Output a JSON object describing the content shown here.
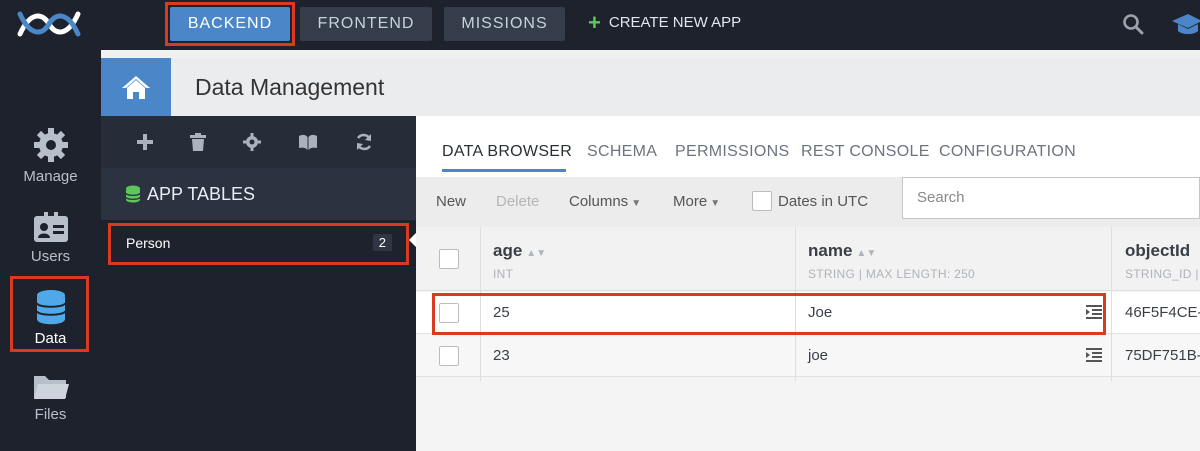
{
  "topbar": {
    "nav": [
      "BACKEND",
      "FRONTEND",
      "MISSIONS"
    ],
    "create_app": "CREATE NEW APP"
  },
  "sidebar": {
    "items": [
      {
        "label": "Manage",
        "icon": "gear-icon"
      },
      {
        "label": "Users",
        "icon": "id-card-icon"
      },
      {
        "label": "Data",
        "icon": "database-icon"
      },
      {
        "label": "Files",
        "icon": "folder-icon"
      }
    ],
    "active": "Data"
  },
  "header": {
    "title": "Data Management"
  },
  "tables_panel": {
    "section_title": "APP TABLES",
    "tables": [
      {
        "name": "Person",
        "count": "2"
      }
    ]
  },
  "tabs": [
    "DATA BROWSER",
    "SCHEMA",
    "PERMISSIONS",
    "REST CONSOLE",
    "CONFIGURATION"
  ],
  "toolbar": {
    "new": "New",
    "delete": "Delete",
    "columns": "Columns",
    "more": "More",
    "dates_utc": "Dates in UTC",
    "search_placeholder": "Search"
  },
  "grid": {
    "columns": [
      {
        "name": "age",
        "type": "INT"
      },
      {
        "name": "name",
        "type": "STRING | MAX LENGTH: 250"
      },
      {
        "name": "objectId",
        "type": "STRING_ID |"
      }
    ],
    "rows": [
      {
        "age": "25",
        "name": "Joe",
        "objectId": "46F5F4CE-("
      },
      {
        "age": "23",
        "name": "joe",
        "objectId": "75DF751B-"
      }
    ]
  },
  "colors": {
    "accent": "#4a86c8",
    "dark_bg": "#1d222c",
    "highlight": "#d93a22",
    "database": "#4fa8e8"
  }
}
